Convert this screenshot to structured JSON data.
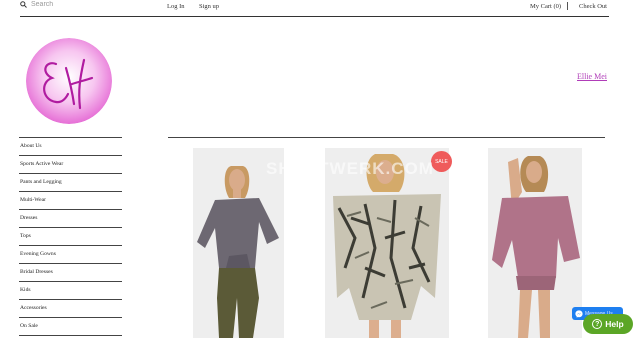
{
  "header": {
    "search_placeholder": "Search",
    "login": "Log In",
    "signup": "Sign up",
    "cart": "My Cart (0)",
    "checkout": "Check Out"
  },
  "brand": {
    "name": "Ellie Mei",
    "logo_text": "EM"
  },
  "sidebar": {
    "items": [
      {
        "label": "About Us"
      },
      {
        "label": "Sports Active Wear"
      },
      {
        "label": "Pants and Legging"
      },
      {
        "label": "Multi-Wear"
      },
      {
        "label": "Dresses"
      },
      {
        "label": "Tops"
      },
      {
        "label": "Evening Gowns"
      },
      {
        "label": "Bridal Dresses"
      },
      {
        "label": "Kids"
      },
      {
        "label": "Accessories"
      },
      {
        "label": "On Sale"
      }
    ]
  },
  "products": [
    {
      "image": "model in grey top and olive harem pants",
      "sale": false
    },
    {
      "image": "model in snake-print kaftan",
      "sale": true,
      "badge": "SALE"
    },
    {
      "image": "model in mauve batwing tunic",
      "sale": false
    }
  ],
  "watermark": "SHOPTWERK.COM",
  "widgets": {
    "messenger_label": "Message Us",
    "help_label": "Help"
  },
  "colors": {
    "brand_accent": "#b03cb8",
    "sale_badge": "#ef5b5b",
    "help_button": "#5ba626",
    "messenger": "#1e7ff0"
  }
}
